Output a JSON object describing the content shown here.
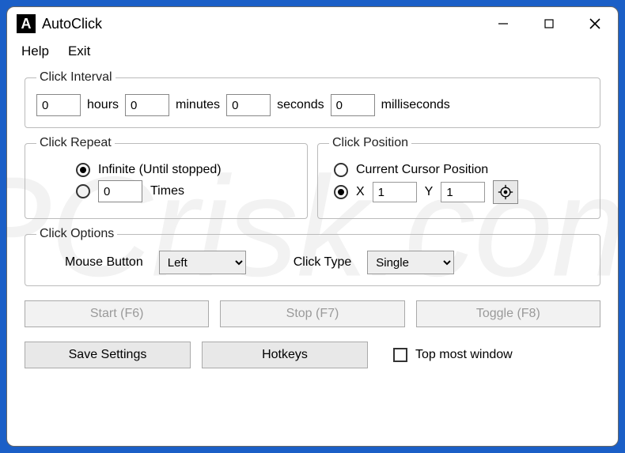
{
  "titlebar": {
    "icon_letter": "A",
    "title": "AutoClick"
  },
  "menubar": {
    "help": "Help",
    "exit": "Exit"
  },
  "interval": {
    "legend": "Click Interval",
    "hours_label": "hours",
    "minutes_label": "minutes",
    "seconds_label": "seconds",
    "ms_label": "milliseconds",
    "hours_value": "0",
    "minutes_value": "0",
    "seconds_value": "0",
    "ms_value": "0"
  },
  "repeat": {
    "legend": "Click Repeat",
    "infinite_label": "Infinite (Until stopped)",
    "times_label": "Times",
    "times_value": "0",
    "selected": "infinite"
  },
  "position": {
    "legend": "Click Position",
    "current_label": "Current Cursor Position",
    "x_label": "X",
    "y_label": "Y",
    "x_value": "1",
    "y_value": "1",
    "selected": "xy"
  },
  "options": {
    "legend": "Click Options",
    "mouse_button_label": "Mouse Button",
    "mouse_button_value": "Left",
    "click_type_label": "Click Type",
    "click_type_value": "Single"
  },
  "buttons": {
    "start": "Start (F6)",
    "stop": "Stop (F7)",
    "toggle": "Toggle (F8)",
    "save_settings": "Save Settings",
    "hotkeys": "Hotkeys"
  },
  "topmost": {
    "label": "Top most window",
    "checked": false
  },
  "watermark": "PCrisk.com"
}
